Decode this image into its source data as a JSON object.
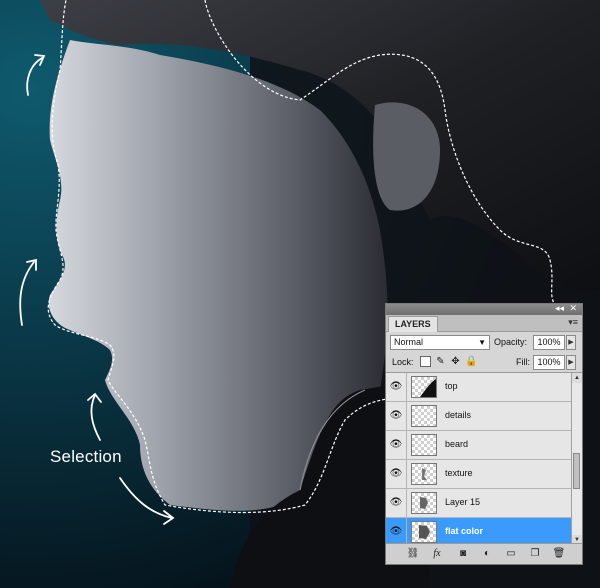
{
  "annotation": {
    "selection_label": "Selection"
  },
  "layers_panel": {
    "tab_label": "LAYERS",
    "collapse_glyph": "◂◂",
    "close_glyph": "✕",
    "menu_glyph": "▾≡",
    "blend_mode": "Normal",
    "opacity_label": "Opacity:",
    "opacity_value": "100%",
    "lock_label": "Lock:",
    "fill_label": "Fill:",
    "fill_value": "100%",
    "layers": [
      {
        "name": "top",
        "selected": false
      },
      {
        "name": "details",
        "selected": false
      },
      {
        "name": "beard",
        "selected": false
      },
      {
        "name": "texture",
        "selected": false
      },
      {
        "name": "Layer 15",
        "selected": false
      },
      {
        "name": "flat color",
        "selected": true
      }
    ],
    "selection_color": "#3a9bfc"
  }
}
